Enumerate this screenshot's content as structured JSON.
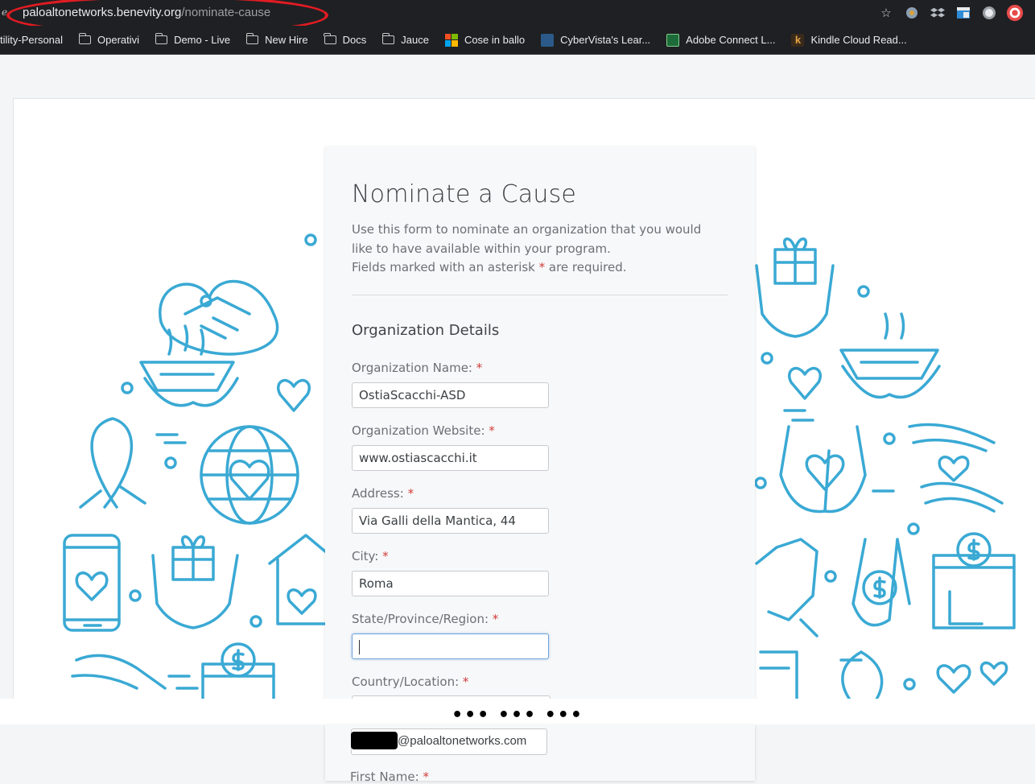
{
  "browser": {
    "url_host": "paloaltonetworks.benevity.org",
    "url_path": "/nominate-cause",
    "bookmarks": [
      {
        "label": "tility-Personal",
        "icon": "none"
      },
      {
        "label": "Operativi",
        "icon": "folder-icon"
      },
      {
        "label": "Demo - Live",
        "icon": "folder-icon"
      },
      {
        "label": "New Hire",
        "icon": "folder-icon"
      },
      {
        "label": "Docs",
        "icon": "folder-icon"
      },
      {
        "label": "Jauce",
        "icon": "folder-icon"
      },
      {
        "label": "Cose in ballo",
        "icon": "microsoft-icon"
      },
      {
        "label": "CyberVista's Lear...",
        "icon": "cybervista-icon"
      },
      {
        "label": "Adobe Connect L...",
        "icon": "adobe-connect-icon"
      },
      {
        "label": "Kindle Cloud Read...",
        "icon": "kindle-icon"
      }
    ],
    "toolbar_icons": [
      "star-icon",
      "extension-icon",
      "dropbox-icon",
      "window-icon",
      "record-icon",
      "profile-icon"
    ]
  },
  "form": {
    "title": "Nominate a Cause",
    "description_line1": "Use this form to nominate an organization that you would like to have available within your program.",
    "description_line2_pre": "Fields marked with an asterisk ",
    "description_asterisk": "*",
    "description_line2_post": " are required.",
    "section_title": "Organization Details",
    "fields": [
      {
        "label": "Organization Name:",
        "value": "OstiaScacchi-ASD"
      },
      {
        "label": "Organization Website:",
        "value": "www.ostiascacchi.it"
      },
      {
        "label": "Address:",
        "value": "Via Galli della Mantica, 44"
      },
      {
        "label": "City:",
        "value": "Roma"
      },
      {
        "label": "State/Province/Region:",
        "value": ""
      },
      {
        "label": "Country/Location:",
        "value": ""
      }
    ],
    "required_mark": "*"
  },
  "gap": {
    "dots": "••• ••• •••"
  },
  "lower": {
    "email_domain": "@paloaltonetworks.com",
    "first_name_label": "First Name:",
    "required_mark": "*"
  },
  "colors": {
    "illustration": "#3aa9d4",
    "accent_red": "#d23c3c",
    "oval_red": "#e01b22"
  }
}
